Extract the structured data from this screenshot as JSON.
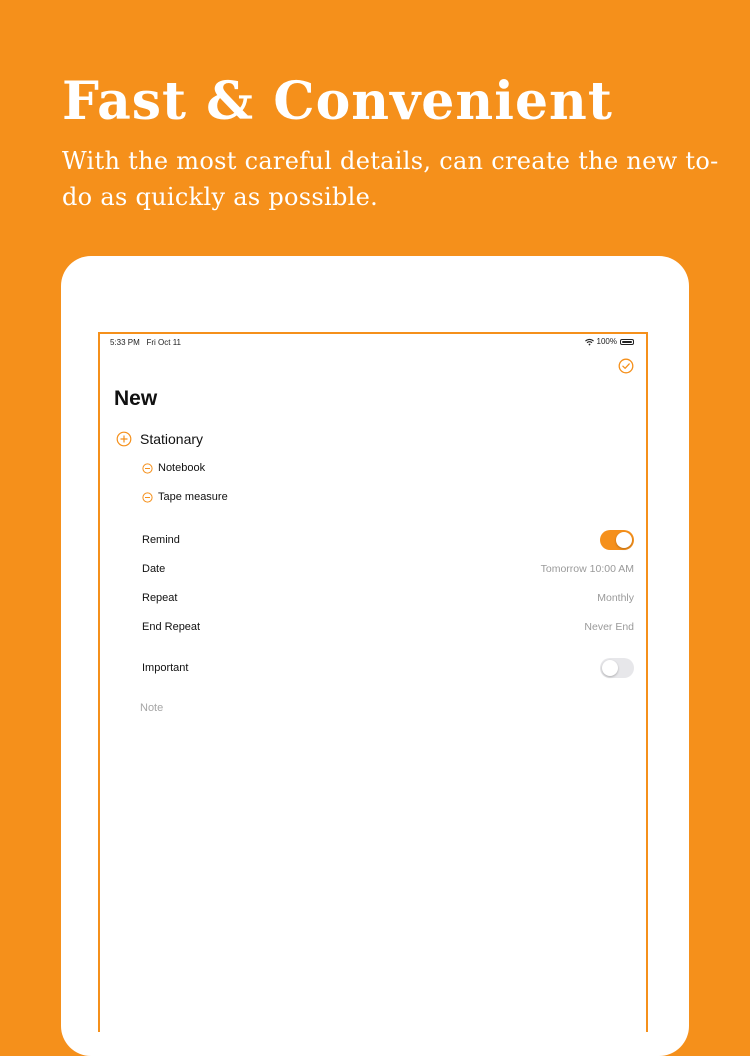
{
  "headline": "Fast & Convenient",
  "subheadline": "With the most careful details, can create the new to-do as quickly as possible.",
  "status_bar": {
    "time": "5:33 PM",
    "date": "Fri Oct 11",
    "battery": "100%"
  },
  "screen": {
    "title": "New",
    "category": {
      "label": "Stationary",
      "items": [
        "Notebook",
        "Tape measure"
      ]
    },
    "settings": {
      "remind": {
        "label": "Remind",
        "on": true
      },
      "date": {
        "label": "Date",
        "value": "Tomorrow 10:00 AM"
      },
      "repeat": {
        "label": "Repeat",
        "value": "Monthly"
      },
      "end_repeat": {
        "label": "End Repeat",
        "value": "Never End"
      },
      "important": {
        "label": "Important",
        "on": false
      }
    },
    "note_placeholder": "Note"
  },
  "colors": {
    "accent": "#F5901B",
    "background": "#F5901B"
  },
  "icons": {
    "add_category": "plus-circle-icon",
    "remove_item": "minus-circle-icon",
    "done": "check-circle-icon",
    "wifi": "wifi-icon",
    "battery": "battery-icon"
  }
}
